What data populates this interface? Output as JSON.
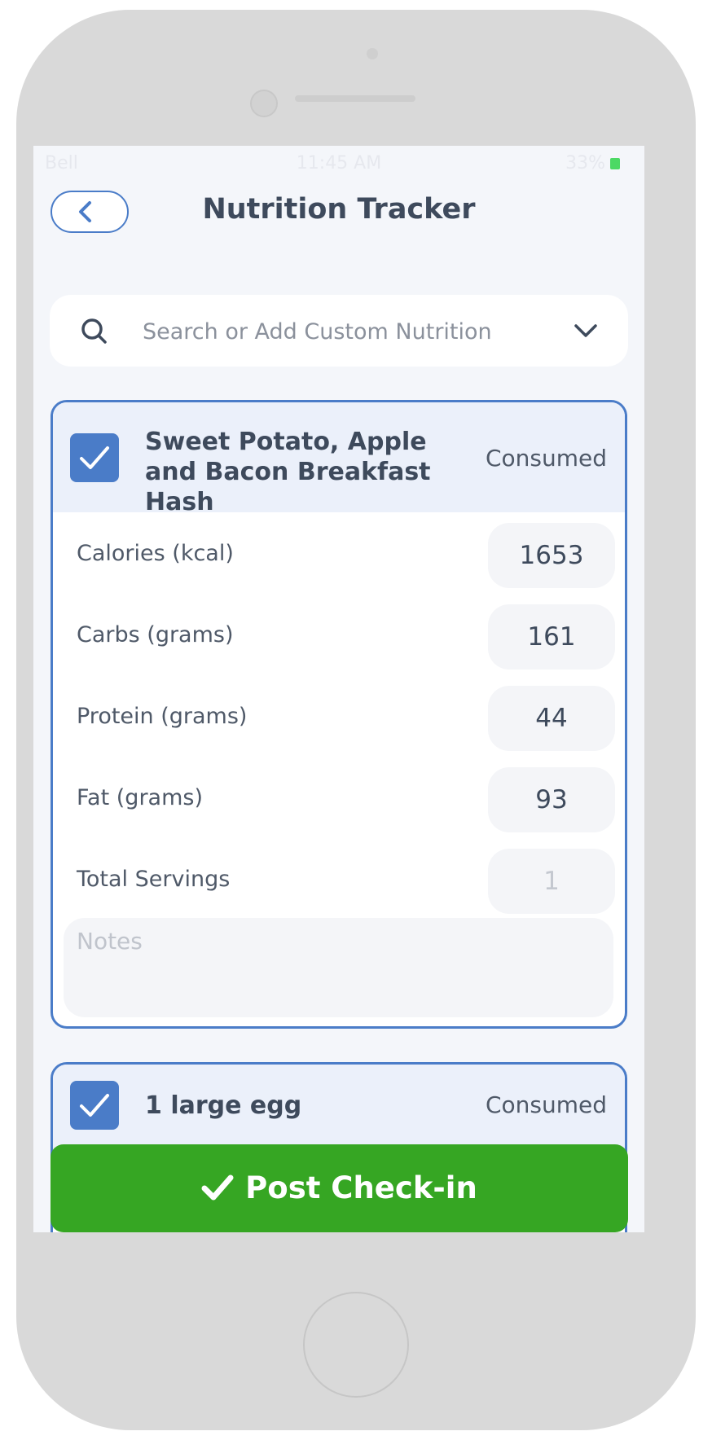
{
  "status_bar": {
    "carrier": "Bell",
    "time": "11:45 AM",
    "battery": "33%"
  },
  "header": {
    "title": "Nutrition Tracker"
  },
  "search": {
    "placeholder": "Search or Add Custom Nutrition"
  },
  "items": [
    {
      "name": "Sweet Potato, Apple and Bacon Breakfast Hash",
      "status": "Consumed",
      "checked": true,
      "fields": [
        {
          "label": "Calories (kcal)",
          "value": "1653"
        },
        {
          "label": "Carbs (grams)",
          "value": "161"
        },
        {
          "label": "Protein (grams)",
          "value": "44"
        },
        {
          "label": "Fat (grams)",
          "value": "93"
        },
        {
          "label": "Total Servings",
          "value": "1"
        }
      ],
      "notes_placeholder": "Notes"
    },
    {
      "name": "1 large egg",
      "status": "Consumed",
      "checked": true
    }
  ],
  "footer": {
    "post_label": "Post Check-in"
  },
  "colors": {
    "accent": "#4a7cc8",
    "post_button": "#36a623",
    "background": "#f4f6fa"
  },
  "icons": [
    "chevron-left-icon",
    "search-icon",
    "chevron-down-icon",
    "checkmark-icon"
  ]
}
